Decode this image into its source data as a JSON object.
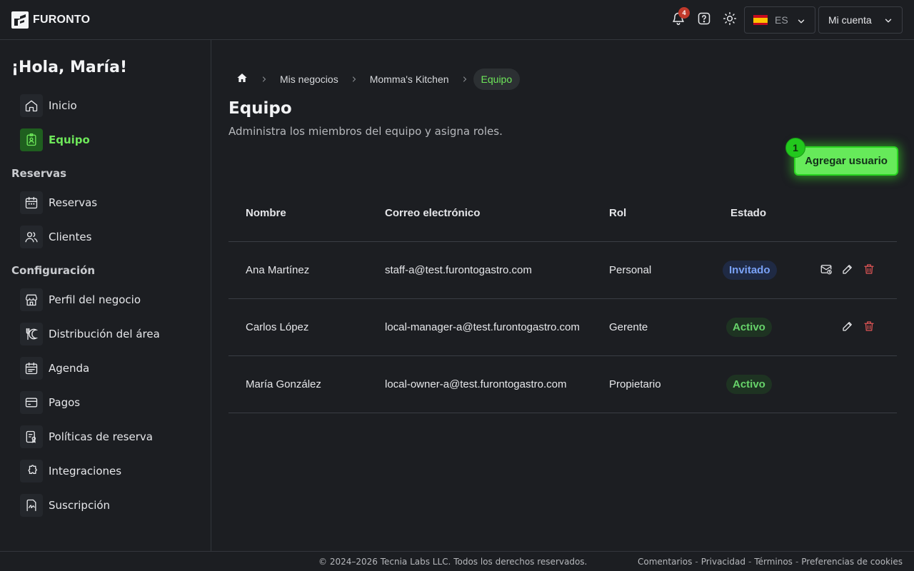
{
  "app": {
    "brand": "FURONTO"
  },
  "header": {
    "notifications_count": "4",
    "language_code": "ES",
    "account_label": "Mi cuenta"
  },
  "sidebar": {
    "greeting": "¡Hola, María!",
    "items_top": [
      {
        "label": "Inicio",
        "icon": "home-icon"
      },
      {
        "label": "Equipo",
        "icon": "team-badge-icon",
        "active": true
      }
    ],
    "section_reservas": "Reservas",
    "items_reservas": [
      {
        "label": "Reservas",
        "icon": "calendar-icon"
      },
      {
        "label": "Clientes",
        "icon": "users-icon"
      }
    ],
    "section_config": "Configuración",
    "items_config": [
      {
        "label": "Perfil del negocio",
        "icon": "store-icon"
      },
      {
        "label": "Distribución del área",
        "icon": "utensils-moon-icon"
      },
      {
        "label": "Agenda",
        "icon": "agenda-icon"
      },
      {
        "label": "Pagos",
        "icon": "card-icon"
      },
      {
        "label": "Políticas de reserva",
        "icon": "policy-icon"
      },
      {
        "label": "Integraciones",
        "icon": "puzzle-icon"
      },
      {
        "label": "Suscripción",
        "icon": "signature-icon"
      }
    ]
  },
  "breadcrumb": {
    "items": [
      "Mis negocios",
      "Momma's Kitchen"
    ],
    "current": "Equipo"
  },
  "page": {
    "title": "Equipo",
    "subtitle": "Administra los miembros del equipo y asigna roles.",
    "add_button": "Agregar usuario",
    "step_marker": "1"
  },
  "table": {
    "headers": {
      "name": "Nombre",
      "email": "Correo electrónico",
      "role": "Rol",
      "status": "Estado"
    },
    "rows": [
      {
        "name": "Ana Martínez",
        "email": "staff-a@test.furontogastro.com",
        "role": "Personal",
        "status": "Invitado",
        "status_type": "invited",
        "actions": [
          "resend",
          "edit",
          "delete"
        ]
      },
      {
        "name": "Carlos López",
        "email": "local-manager-a@test.furontogastro.com",
        "role": "Gerente",
        "status": "Activo",
        "status_type": "active",
        "actions": [
          "edit",
          "delete"
        ]
      },
      {
        "name": "María González",
        "email": "local-owner-a@test.furontogastro.com",
        "role": "Propietario",
        "status": "Activo",
        "status_type": "active",
        "actions": []
      }
    ]
  },
  "footer": {
    "copyright": "© 2024–2026 Tecnia Labs LLC. Todos los derechos reservados.",
    "links": [
      "Comentarios",
      "Privacidad",
      "Términos",
      "Preferencias de cookies"
    ],
    "separator": "-"
  },
  "colors": {
    "accent": "#6ee75a",
    "invited": "#7aa2f7",
    "danger": "#e05555"
  }
}
